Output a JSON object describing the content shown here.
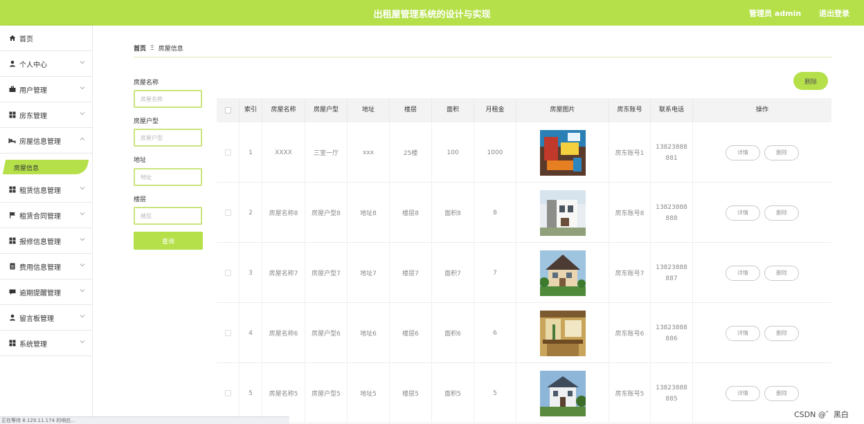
{
  "header": {
    "title": "出租屋管理系统的设计与实现",
    "user": "管理员 admin",
    "logout": "退出登录"
  },
  "sidebar": {
    "items": [
      {
        "label": "首页",
        "icon": "home-icon"
      },
      {
        "label": "个人中心",
        "icon": "user-icon"
      },
      {
        "label": "用户管理",
        "icon": "briefcase-icon"
      },
      {
        "label": "房东管理",
        "icon": "grid-icon"
      },
      {
        "label": "房屋信息管理",
        "icon": "bed-icon"
      },
      {
        "label": "租赁信息管理",
        "icon": "grid-icon"
      },
      {
        "label": "租赁合同管理",
        "icon": "flag-icon"
      },
      {
        "label": "报修信息管理",
        "icon": "grid-icon"
      },
      {
        "label": "费用信息管理",
        "icon": "document-icon"
      },
      {
        "label": "逾期提醒管理",
        "icon": "message-icon"
      },
      {
        "label": "留言板管理",
        "icon": "user-icon"
      },
      {
        "label": "系统管理",
        "icon": "grid-icon"
      }
    ],
    "active_sub": "房屋信息"
  },
  "breadcrumb": {
    "home": "首页",
    "separator": "Ξ",
    "current": "房屋信息"
  },
  "filters": {
    "name_label": "房屋名称",
    "name_placeholder": "房屋名称",
    "type_label": "房屋户型",
    "type_placeholder": "房屋户型",
    "address_label": "地址",
    "address_placeholder": "地址",
    "floor_label": "楼层",
    "floor_placeholder": "楼层",
    "query_button": "查询"
  },
  "toolbar": {
    "delete_button": "删除"
  },
  "table": {
    "columns": [
      "索引",
      "房屋名称",
      "房屋户型",
      "地址",
      "楼层",
      "面积",
      "月租金",
      "房屋图片",
      "房东账号",
      "联系电话",
      "操作"
    ],
    "rows": [
      {
        "index": "1",
        "name": "XXXX",
        "type": "三室一厅",
        "address": "xxx",
        "floor": "25楼",
        "area": "100",
        "rent": "1000",
        "owner": "房东账号1",
        "phone_1": "13823888",
        "phone_2": "881",
        "detail": "详情",
        "delete": "删除"
      },
      {
        "index": "2",
        "name": "房屋名称8",
        "type": "房屋户型8",
        "address": "地址8",
        "floor": "楼层8",
        "area": "面积8",
        "rent": "8",
        "owner": "房东账号8",
        "phone_1": "13823888",
        "phone_2": "888",
        "detail": "详情",
        "delete": "删除"
      },
      {
        "index": "3",
        "name": "房屋名称7",
        "type": "房屋户型7",
        "address": "地址7",
        "floor": "楼层7",
        "area": "面积7",
        "rent": "7",
        "owner": "房东账号7",
        "phone_1": "13823888",
        "phone_2": "887",
        "detail": "详情",
        "delete": "删除"
      },
      {
        "index": "4",
        "name": "房屋名称6",
        "type": "房屋户型6",
        "address": "地址6",
        "floor": "楼层6",
        "area": "面积6",
        "rent": "6",
        "owner": "房东账号6",
        "phone_1": "13823888",
        "phone_2": "886",
        "detail": "详情",
        "delete": "删除"
      },
      {
        "index": "5",
        "name": "房屋名称5",
        "type": "房屋户型5",
        "address": "地址5",
        "floor": "楼层5",
        "area": "面积5",
        "rent": "5",
        "owner": "房东账号5",
        "phone_1": "13823888",
        "phone_2": "885",
        "detail": "详情",
        "delete": "删除"
      }
    ]
  },
  "status_bar": "正在等待 8.129.11.174 的响应...",
  "watermark": "CSDN @゛黑白",
  "colors": {
    "accent": "#b5e04a",
    "border_accent": "#c9e57b",
    "header_bg": "#f3f3f3"
  }
}
